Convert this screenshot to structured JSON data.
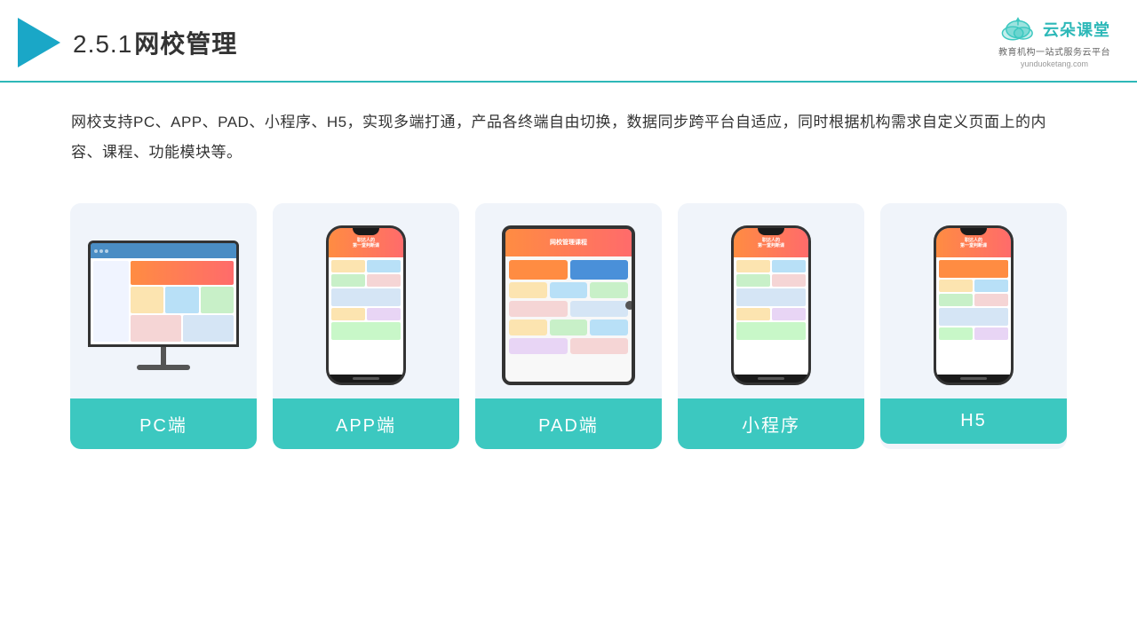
{
  "header": {
    "title": "2.5.1网校管理",
    "title_num": "2.5.1",
    "title_text": "网校管理",
    "logo_text": "云朵课堂",
    "logo_url": "yunduoketang.com",
    "logo_tagline": "教育机构一站式服务云平台"
  },
  "description": {
    "text": "网校支持PC、APP、PAD、小程序、H5，实现多端打通，产品各终端自由切换，数据同步跨平台自适应，同时根据机构需求自定义页面上的内容、课程、功能模块等。"
  },
  "cards": [
    {
      "id": "pc",
      "label": "PC端"
    },
    {
      "id": "app",
      "label": "APP端"
    },
    {
      "id": "pad",
      "label": "PAD端"
    },
    {
      "id": "miniprogram",
      "label": "小程序"
    },
    {
      "id": "h5",
      "label": "H5"
    }
  ],
  "colors": {
    "teal": "#3cc8c0",
    "accent": "#1aa7c7",
    "card_bg": "#f0f4fa"
  }
}
